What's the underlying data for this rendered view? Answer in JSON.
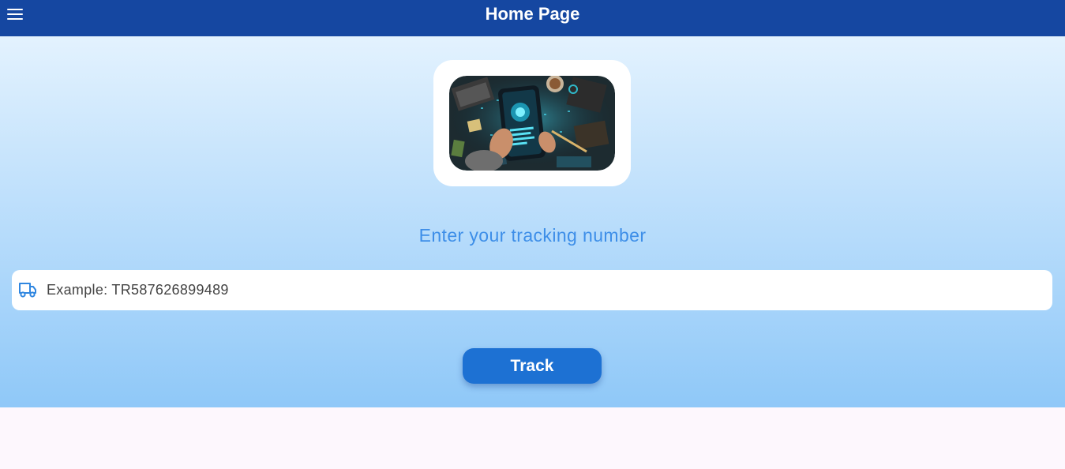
{
  "appbar": {
    "title": "Home Page",
    "menu_icon": "hamburger-menu-icon",
    "background": "#1547a1"
  },
  "hero": {
    "image_alt": "Hands holding a smartphone with a glowing tracking app over a busy desk"
  },
  "tracking": {
    "prompt": "Enter your tracking number",
    "input_icon": "truck-icon",
    "placeholder": "Example: TR587626899489",
    "value": ""
  },
  "actions": {
    "track_label": "Track",
    "button_color": "#1d71d3"
  },
  "colors": {
    "prompt_text": "#3d8ee8",
    "gradient_top": "#e3f2fe",
    "gradient_bottom": "#8fc8f8",
    "page_background": "#fdf7fd"
  }
}
